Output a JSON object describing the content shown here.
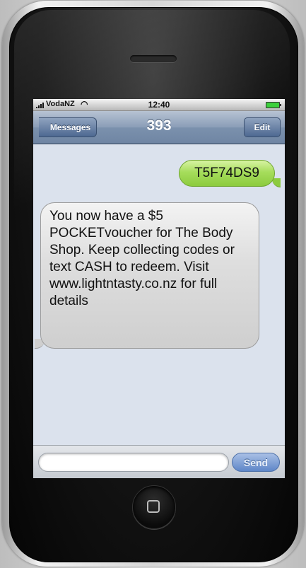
{
  "status_bar": {
    "carrier": "VodaNZ",
    "time": "12:40",
    "signal_icon": "signal-bars-icon",
    "wifi_icon": "wifi-icon",
    "battery_icon": "battery-icon"
  },
  "nav": {
    "back_label": "Messages",
    "title": "393",
    "edit_label": "Edit"
  },
  "messages": [
    {
      "direction": "sent",
      "text": "T5F74DS9"
    },
    {
      "direction": "received",
      "text": "You now have a $5 POCKETvoucher for The Body Shop.  Keep collecting codes or text CASH to redeem.  Visit www.lightntasty.co.nz for full details"
    }
  ],
  "compose": {
    "value": "",
    "send_label": "Send"
  },
  "colors": {
    "sent_bubble": "#a6dd5c",
    "received_bubble": "#dedede",
    "screen_bg": "#dbe2ed",
    "nav_bar": "#8a9db7"
  }
}
